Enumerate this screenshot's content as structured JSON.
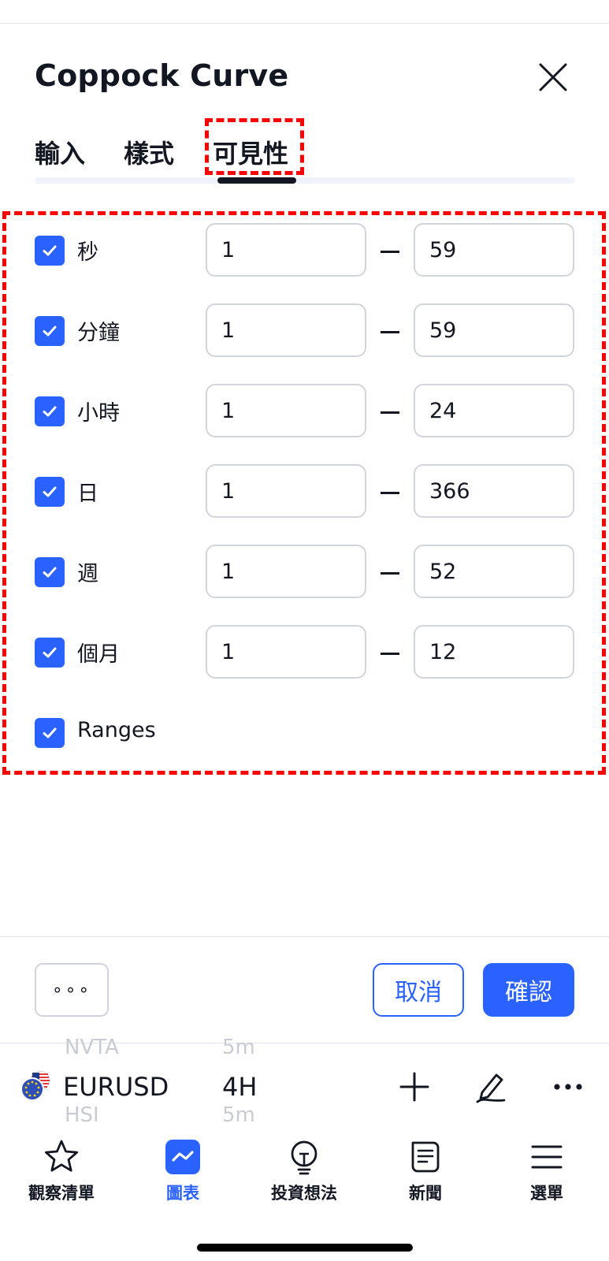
{
  "dialog": {
    "title": "Coppock Curve",
    "tabs": [
      {
        "label": "輸入"
      },
      {
        "label": "樣式"
      },
      {
        "label": "可見性",
        "active": true
      }
    ]
  },
  "visibility_rows": [
    {
      "label": "秒",
      "checked": true,
      "from": "1",
      "to": "59"
    },
    {
      "label": "分鐘",
      "checked": true,
      "from": "1",
      "to": "59"
    },
    {
      "label": "小時",
      "checked": true,
      "from": "1",
      "to": "24"
    },
    {
      "label": "日",
      "checked": true,
      "from": "1",
      "to": "366"
    },
    {
      "label": "週",
      "checked": true,
      "from": "1",
      "to": "52"
    },
    {
      "label": "個月",
      "checked": true,
      "from": "1",
      "to": "12"
    },
    {
      "label": "Ranges",
      "checked": true
    }
  ],
  "footer": {
    "more_label": "∘∘∘",
    "cancel_label": "取消",
    "ok_label": "確認"
  },
  "symbol_bar": {
    "ghost_prev_symbol": "NVTA",
    "ghost_prev_interval": "5m",
    "symbol": "EURUSD",
    "interval": "4H",
    "ghost_next_symbol": "HSI",
    "ghost_next_interval": "5m"
  },
  "bottom_nav": [
    {
      "label": "觀察清單",
      "icon": "star-icon"
    },
    {
      "label": "圖表",
      "icon": "chart-icon",
      "active": true
    },
    {
      "label": "投資想法",
      "icon": "lightbulb-icon"
    },
    {
      "label": "新聞",
      "icon": "news-icon"
    },
    {
      "label": "選單",
      "icon": "menu-icon"
    }
  ],
  "colors": {
    "accent": "#2962ff",
    "highlight": "#ff0000",
    "text": "#131722"
  }
}
